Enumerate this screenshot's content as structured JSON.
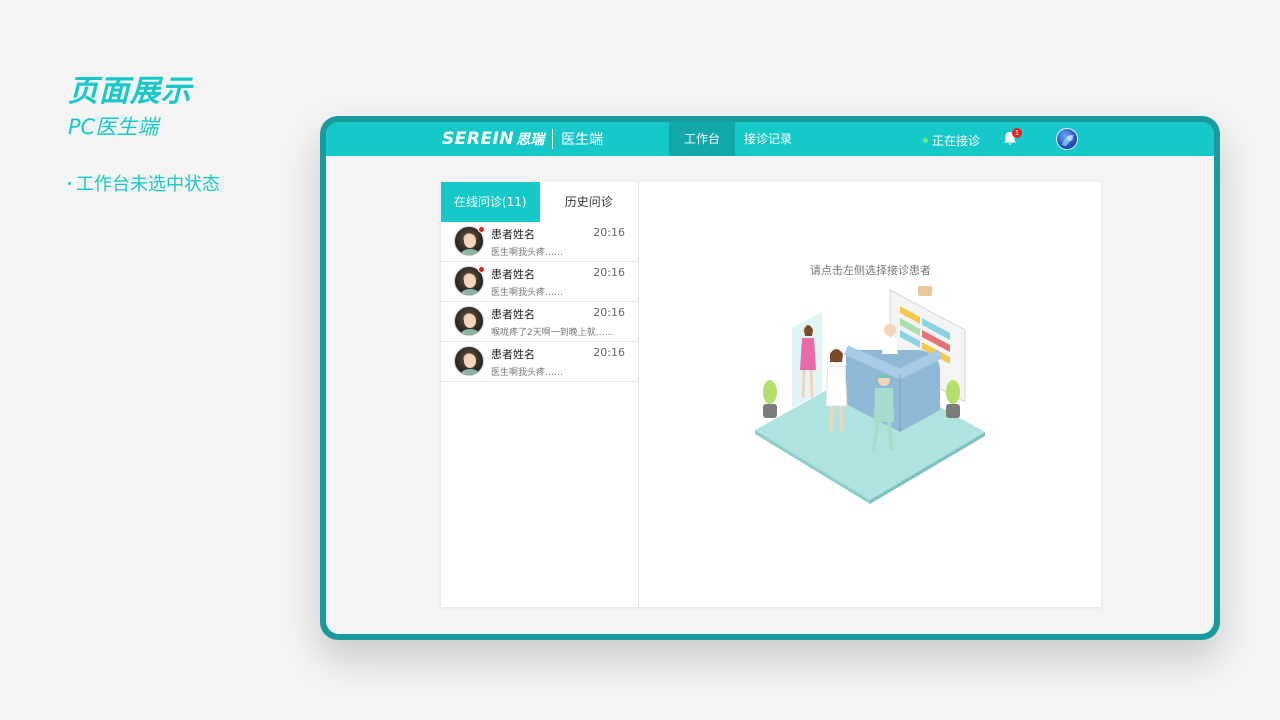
{
  "caption": {
    "title": "页面展示",
    "subtitle": "PC医生端",
    "note": "工作台未选中状态"
  },
  "colors": {
    "accent": "#17c8c9",
    "frame": "#199a9c",
    "nav_active": "#12a7a8",
    "unread_dot": "#e2231a",
    "online_led": "#6cf06c"
  },
  "topbar": {
    "brand": "SEREIN",
    "brand_cn": "思瑞",
    "client": "医生端",
    "nav": [
      {
        "label": "工作台",
        "active": true
      },
      {
        "label": "接诊记录",
        "active": false
      }
    ],
    "status": "正在接诊",
    "notification_count": "1",
    "icons": {
      "bell": "bell-icon",
      "avatar": "user-avatar"
    }
  },
  "list": {
    "tabs": [
      {
        "label": "在线问诊(11)",
        "active": true
      },
      {
        "label": "历史问诊",
        "active": false
      }
    ],
    "items": [
      {
        "name": "患者姓名",
        "time": "20:16",
        "message": "医生啊我头疼……",
        "unread": true
      },
      {
        "name": "患者姓名",
        "time": "20:16",
        "message": "医生啊我头疼……",
        "unread": true
      },
      {
        "name": "患者姓名",
        "time": "20:16",
        "message": "喉咙疼了2天啊一到晚上就……",
        "unread": false
      },
      {
        "name": "患者姓名",
        "time": "20:16",
        "message": "医生啊我头疼……",
        "unread": false
      }
    ]
  },
  "detail": {
    "empty_tip": "请点击左侧选择接诊患者"
  }
}
